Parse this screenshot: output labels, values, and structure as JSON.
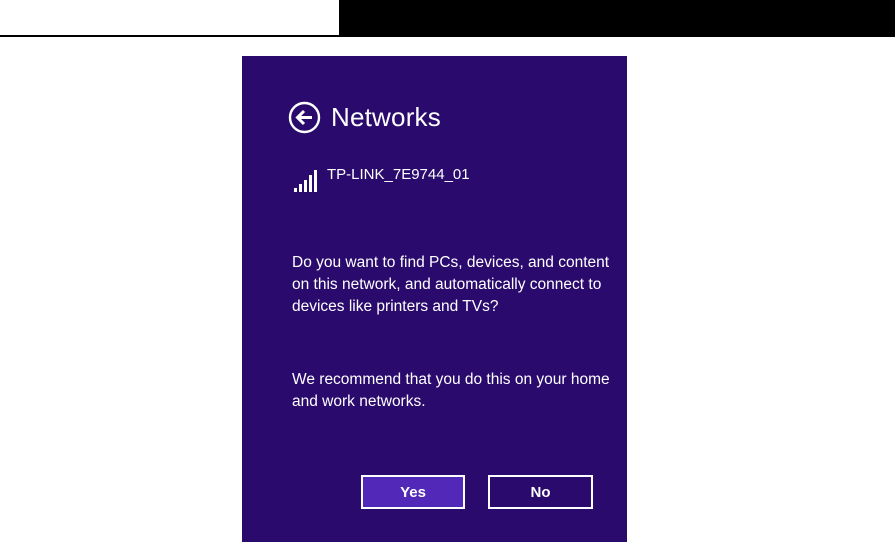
{
  "panel": {
    "title": "Networks",
    "back_icon": "back-arrow-circle-icon",
    "network": {
      "name": "TP-LINK_7E9744_01",
      "icon": "wifi-signal-bars-icon"
    },
    "question": "Do you want to find PCs, devices, and content on this network, and automatically connect to devices like printers and TVs?",
    "recommendation": "We recommend that you do this on your home and work networks.",
    "buttons": {
      "yes_label": "Yes",
      "no_label": "No"
    }
  },
  "colors": {
    "panel_background": "#2a0b6d",
    "yes_button_background": "#5128b8",
    "text": "#ffffff",
    "top_band": "#000000"
  }
}
